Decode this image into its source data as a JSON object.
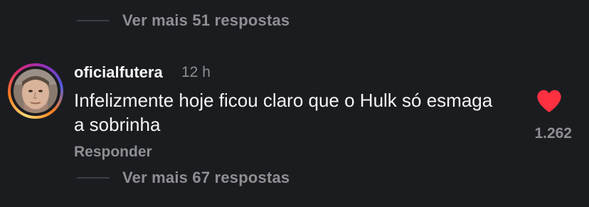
{
  "thread_top": {
    "view_more_replies": "Ver mais 51 respostas"
  },
  "comment": {
    "username": "oficialfutera",
    "time": "12 h",
    "text": "Infelizmente hoje ficou claro que o Hulk só esmaga a sobrinha",
    "reply_label": "Responder",
    "likes": "1.262",
    "liked": true,
    "heart_color": "#ff3040",
    "view_more_replies": "Ver mais 67 respostas",
    "avatar_icon": "profile-avatar-story-ring"
  }
}
